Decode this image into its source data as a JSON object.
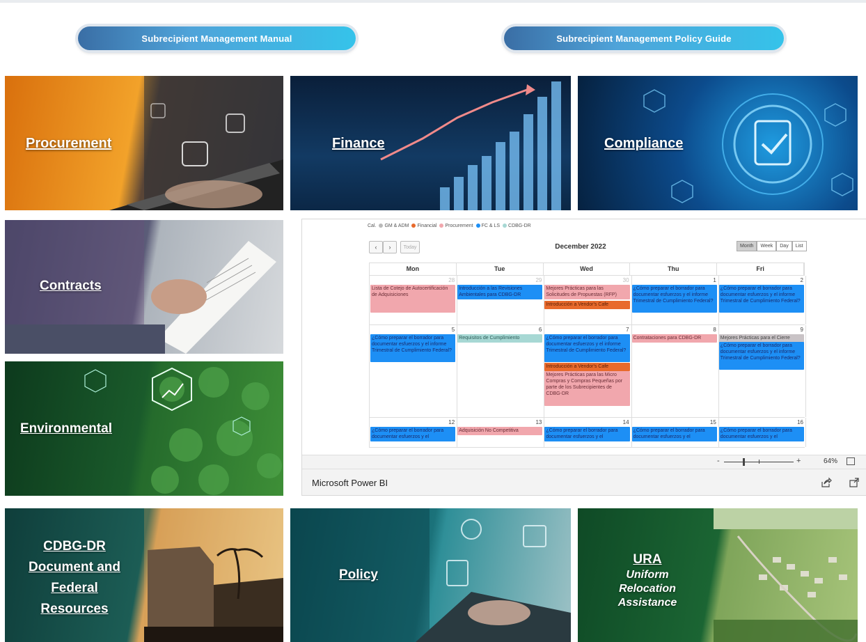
{
  "buttons": {
    "manual": "Subrecipient Management Manual",
    "policy_guide": "Subrecipient Management Policy Guide"
  },
  "tiles": {
    "procurement": "Procurement",
    "finance": "Finance",
    "compliance": "Compliance",
    "contracts": "Contracts",
    "environmental": "Environmental",
    "cdbg": [
      "CDBG-DR",
      "Document and",
      "Federal",
      "Resources"
    ],
    "policy": "Policy",
    "ura": {
      "title": "URA",
      "sub": [
        "Uniform",
        "Relocation",
        "Assistance"
      ]
    }
  },
  "calendar": {
    "legend_prefix": "Cal.",
    "legend": [
      {
        "label": "GM & ADM",
        "color": "#b9b9b9"
      },
      {
        "label": "Financial",
        "color": "#e86a2c"
      },
      {
        "label": "Procurement",
        "color": "#f1a7ad"
      },
      {
        "label": "FC & LS",
        "color": "#1d8ff5"
      },
      {
        "label": "CDBG-DR",
        "color": "#a7d8d4"
      }
    ],
    "today": "Today",
    "title": "December 2022",
    "views": [
      "Month",
      "Week",
      "Day",
      "List"
    ],
    "days": [
      "Mon",
      "Tue",
      "Wed",
      "Thu",
      "Fri"
    ],
    "weeks": [
      {
        "nums": [
          "28",
          "29",
          "30",
          "1",
          "2"
        ],
        "events": [
          {
            "col": 0,
            "row": 0,
            "rows": 4,
            "color": "pink",
            "text": "Lista de Cotejo de Autocertificación de Adquisiciones"
          },
          {
            "col": 1,
            "row": 0,
            "rows": 2,
            "color": "blue",
            "text": "Introducción a las Revisiones Ambientales para CDBG-DR"
          },
          {
            "col": 2,
            "row": 0,
            "rows": 2,
            "color": "pink",
            "text": "Mejores Prácticas para las Solicitudes de Propuestas (RFP)"
          },
          {
            "col": 2,
            "row": 2.4,
            "rows": 1,
            "color": "orange",
            "text": "Introducción a Vendor's Cafe"
          },
          {
            "col": 3,
            "row": 0,
            "rows": 4,
            "color": "blue",
            "text": "¿Cómo preparar el borrador para documentar esfuerzos y el informe Trimestral de Cumplimiento Federal?"
          },
          {
            "col": 4,
            "row": 0,
            "rows": 4,
            "color": "blue",
            "text": "¿Cómo preparar el borrador para documentar esfuerzos y el informe Trimestral de Cumplimiento Federal?"
          }
        ]
      },
      {
        "nums": [
          "5",
          "6",
          "7",
          "8",
          "9"
        ],
        "events": [
          {
            "col": 0,
            "row": 0,
            "rows": 4,
            "color": "blue",
            "text": "¿Cómo preparar el borrador para documentar esfuerzos y el informe Trimestral de Cumplimiento Federal?"
          },
          {
            "col": 1,
            "row": 0,
            "rows": 1,
            "color": "teal",
            "text": "Requisitos de Cumplimiento"
          },
          {
            "col": 2,
            "row": 0,
            "rows": 4,
            "color": "blue",
            "text": "¿Cómo preparar el borrador para documentar esfuerzos y el informe Trimestral de Cumplimiento Federal?"
          },
          {
            "col": 2,
            "row": 4.3,
            "rows": 1,
            "color": "orange",
            "text": "Introducción a Vendor's Cafe"
          },
          {
            "col": 2,
            "row": 5.5,
            "rows": 5,
            "color": "pink",
            "text": "Mejores Prácticas para las Micro Compras y Compras Pequeñas por parte de los Subrecipientes de CDBG-DR"
          },
          {
            "col": 3,
            "row": 0,
            "rows": 1,
            "color": "pink",
            "text": "Contrataciones para CDBG-DR"
          },
          {
            "col": 4,
            "row": 0,
            "rows": 1,
            "color": "gray",
            "text": "Mejores Prácticas para el Cierre"
          },
          {
            "col": 4,
            "row": 1.1,
            "rows": 4,
            "color": "blue",
            "text": "¿Cómo preparar el borrador para documentar esfuerzos y el informe Trimestral de Cumplimiento Federal?"
          }
        ]
      },
      {
        "nums": [
          "12",
          "13",
          "14",
          "15",
          "16"
        ],
        "events": [
          {
            "col": 0,
            "row": 0,
            "rows": 2,
            "color": "blue",
            "text": "¿Cómo preparar el borrador para documentar esfuerzos y el"
          },
          {
            "col": 1,
            "row": 0,
            "rows": 1,
            "color": "pink",
            "text": "Adquisición No Competitiva"
          },
          {
            "col": 2,
            "row": 0,
            "rows": 2,
            "color": "blue",
            "text": "¿Cómo preparar el borrador para documentar esfuerzos y el"
          },
          {
            "col": 3,
            "row": 0,
            "rows": 2,
            "color": "blue",
            "text": "¿Cómo preparar el borrador para documentar esfuerzos y el"
          },
          {
            "col": 4,
            "row": 0,
            "rows": 2,
            "color": "blue",
            "text": "¿Cómo preparar el borrador para documentar esfuerzos y el"
          }
        ]
      }
    ]
  },
  "powerbi": {
    "zoom_minus": "-",
    "zoom_plus": "+",
    "zoom_level": "64%",
    "brand": "Microsoft Power BI"
  }
}
